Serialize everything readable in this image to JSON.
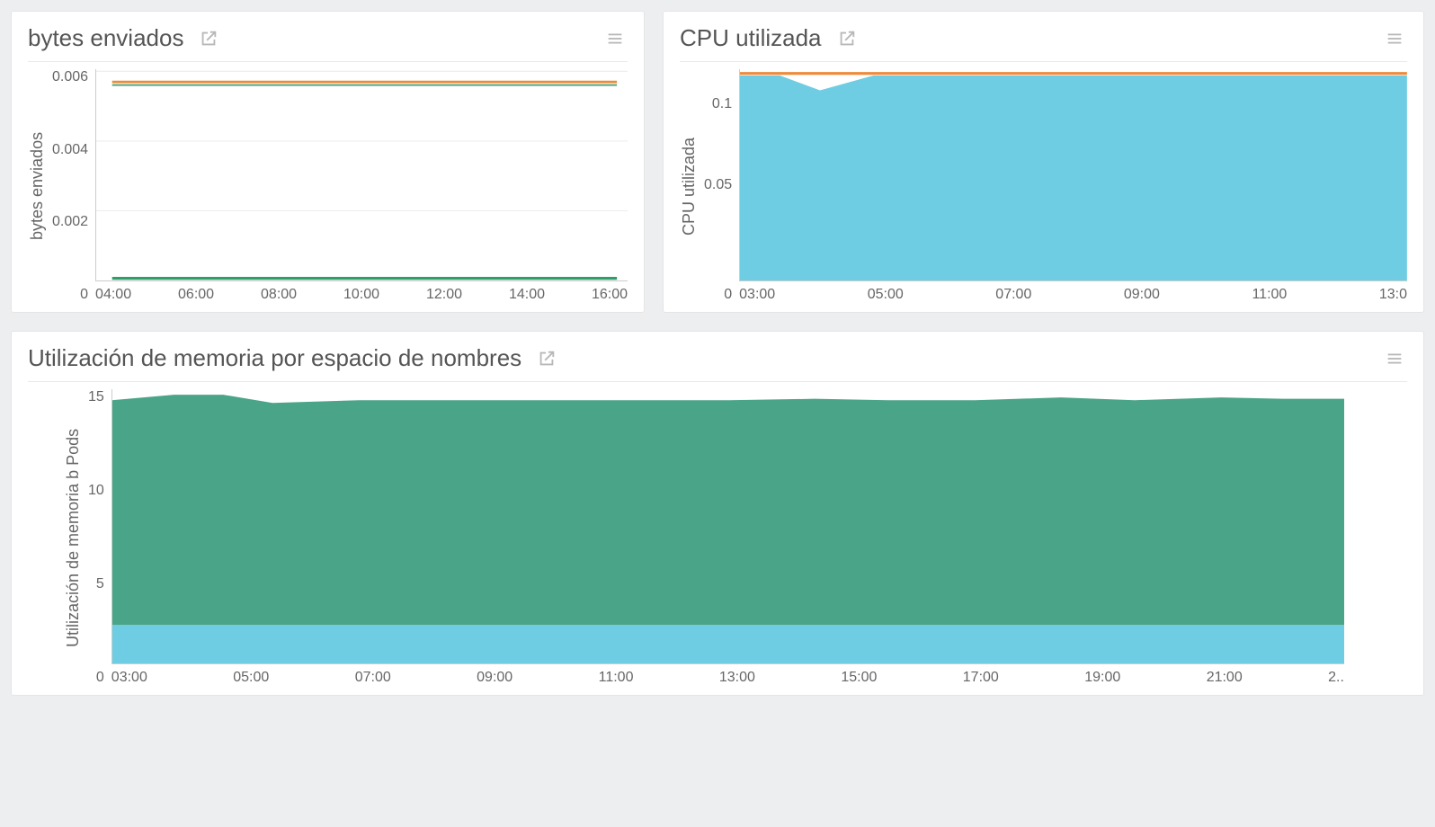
{
  "cards": {
    "bytes_sent": {
      "title": "bytes enviados",
      "ylabel": "bytes enviados",
      "yticks": [
        "0.006",
        "0.004",
        "0.002",
        "0"
      ],
      "xticks": [
        "04:00",
        "06:00",
        "08:00",
        "10:00",
        "12:00",
        "14:00",
        "16:00"
      ]
    },
    "cpu_used": {
      "title": "CPU utilizada",
      "ylabel": "CPU utilizada",
      "yticks": [
        "0.1",
        "0.05",
        "0"
      ],
      "xticks": [
        "03:00",
        "05:00",
        "07:00",
        "09:00",
        "11:00",
        "13:0"
      ]
    },
    "mem_by_ns": {
      "title": "Utilización de memoria por espacio de nombres",
      "ylabel": "Utilización de memoria b Pods",
      "yticks": [
        "15",
        "10",
        "5",
        "0"
      ],
      "xticks": [
        "03:00",
        "05:00",
        "07:00",
        "09:00",
        "11:00",
        "13:00",
        "15:00",
        "17:00",
        "19:00",
        "21:00",
        "2.."
      ]
    }
  },
  "icons": {
    "open": "open-external-icon",
    "menu": "hamburger-menu-icon"
  },
  "chart_data": [
    {
      "id": "bytes_sent",
      "type": "line",
      "title": "bytes enviados",
      "xlabel": "",
      "ylabel": "bytes enviados",
      "ylim": [
        0,
        0.006
      ],
      "x": [
        "04:00",
        "05:00",
        "06:00",
        "07:00",
        "08:00",
        "09:00",
        "10:00",
        "11:00",
        "12:00",
        "13:00",
        "14:00",
        "15:00",
        "16:00",
        "17:00"
      ],
      "series": [
        {
          "name": "series-1-orange",
          "color": "#e98b39",
          "values": [
            0.006,
            0.006,
            0.006,
            0.006,
            0.006,
            0.006,
            0.006,
            0.006,
            0.006,
            0.006,
            0.006,
            0.006,
            0.006,
            0.006
          ]
        },
        {
          "name": "series-2-green",
          "color": "#2e9e6b",
          "values": [
            0,
            0,
            0,
            0,
            0,
            0,
            0,
            0,
            0,
            0,
            0,
            0,
            0,
            0
          ]
        }
      ]
    },
    {
      "id": "cpu_used",
      "type": "area",
      "title": "CPU utilizada",
      "xlabel": "",
      "ylabel": "CPU utilizada",
      "ylim": [
        0,
        0.13
      ],
      "x": [
        "03:00",
        "04:00",
        "05:00",
        "06:00",
        "07:00",
        "08:00",
        "09:00",
        "10:00",
        "11:00",
        "12:00",
        "13:00"
      ],
      "series": [
        {
          "name": "limit-orange",
          "color": "#ef8a3a",
          "values": [
            0.13,
            0.13,
            0.13,
            0.13,
            0.13,
            0.13,
            0.13,
            0.13,
            0.13,
            0.13,
            0.13
          ]
        },
        {
          "name": "usage-blue",
          "color": "#6ecde3",
          "values": [
            0.128,
            0.119,
            0.129,
            0.13,
            0.13,
            0.13,
            0.13,
            0.13,
            0.13,
            0.13,
            0.13
          ]
        }
      ]
    },
    {
      "id": "mem_by_ns",
      "type": "area",
      "title": "Utilización de memoria por espacio de nombres",
      "xlabel": "",
      "ylabel": "Utilización de memoria b Pods",
      "ylim": [
        0,
        15.2
      ],
      "x": [
        "03:00",
        "05:00",
        "07:00",
        "09:00",
        "11:00",
        "13:00",
        "15:00",
        "17:00",
        "19:00",
        "21:00",
        "23:00"
      ],
      "series": [
        {
          "name": "namespace-a-green",
          "color": "#4aa487",
          "values": [
            14.9,
            15.2,
            14.7,
            14.8,
            14.8,
            14.8,
            14.9,
            14.8,
            15.0,
            14.9,
            15.0
          ]
        },
        {
          "name": "namespace-b-blue",
          "color": "#6ecde3",
          "values": [
            2.1,
            2.1,
            2.0,
            2.0,
            2.0,
            2.0,
            2.0,
            2.0,
            2.0,
            2.1,
            2.1
          ]
        }
      ]
    }
  ]
}
